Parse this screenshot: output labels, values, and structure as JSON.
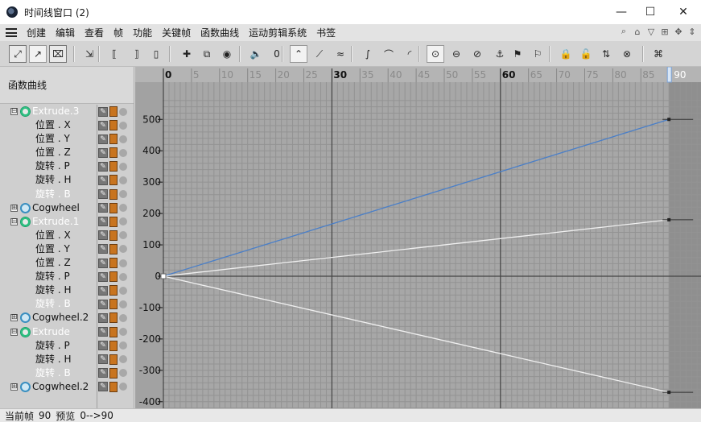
{
  "window": {
    "title": "时间线窗口 (2)",
    "controls": [
      "—",
      "☐",
      "✕"
    ]
  },
  "menu": {
    "items": [
      "创建",
      "编辑",
      "查看",
      "帧",
      "功能",
      "关键帧",
      "函数曲线",
      "运动剪辑系统",
      "书签"
    ],
    "right_icons": [
      "search-icon",
      "home-icon",
      "filter-icon",
      "add-panel-icon",
      "move-icon",
      "expand-icon"
    ]
  },
  "toolbar": {
    "icons": [
      "key-mode-icon",
      "fcurve-mode-icon",
      "motion-mode-icon",
      "snap-icon",
      "range-left-icon",
      "range-mid-icon",
      "range-right-icon",
      "add-key-icon",
      "add-keys-icon",
      "record-key-icon",
      "sound-icon",
      "zero-key-icon",
      "peak-icon",
      "linear-icon",
      "break-icon",
      "spline-icon",
      "ease-icon",
      "ease-out-icon",
      "clamp-icon",
      "zero-angle-icon",
      "zero-length-icon",
      "lock-tangent-icon",
      "lock-time-icon",
      "lock-value-icon",
      "key-lock-icon",
      "key-lock-time-icon",
      "key-lock-value-icon",
      "mute-icon",
      "motion-clip-icon"
    ]
  },
  "left_panel": {
    "header": "函数曲线",
    "rows": [
      {
        "kind": "obj",
        "label": "Extrude.3",
        "icon": "extrude",
        "expander": "⊟",
        "highlight": true
      },
      {
        "kind": "track",
        "label": "位置 . X",
        "highlight": false
      },
      {
        "kind": "track",
        "label": "位置 . Y",
        "highlight": false
      },
      {
        "kind": "track",
        "label": "位置 . Z",
        "highlight": false
      },
      {
        "kind": "track",
        "label": "旋转 . P",
        "highlight": false
      },
      {
        "kind": "track",
        "label": "旋转 . H",
        "highlight": false
      },
      {
        "kind": "track",
        "label": "旋转 . B",
        "highlight": true
      },
      {
        "kind": "obj",
        "label": "Cogwheel",
        "icon": "cog",
        "expander": "⊞",
        "highlight": false
      },
      {
        "kind": "obj",
        "label": "Extrude.1",
        "icon": "extrude",
        "expander": "⊟",
        "highlight": true
      },
      {
        "kind": "track",
        "label": "位置 . X",
        "highlight": false
      },
      {
        "kind": "track",
        "label": "位置 . Y",
        "highlight": false
      },
      {
        "kind": "track",
        "label": "位置 . Z",
        "highlight": false
      },
      {
        "kind": "track",
        "label": "旋转 . P",
        "highlight": false
      },
      {
        "kind": "track",
        "label": "旋转 . H",
        "highlight": false
      },
      {
        "kind": "track",
        "label": "旋转 . B",
        "highlight": true
      },
      {
        "kind": "obj",
        "label": "Cogwheel.2",
        "icon": "cog",
        "expander": "⊞",
        "highlight": false
      },
      {
        "kind": "obj",
        "label": "Extrude",
        "icon": "extrude",
        "expander": "⊟",
        "highlight": true
      },
      {
        "kind": "track",
        "label": "旋转 . P",
        "highlight": false
      },
      {
        "kind": "track",
        "label": "旋转 . H",
        "highlight": false
      },
      {
        "kind": "track",
        "label": "旋转 . B",
        "highlight": true
      },
      {
        "kind": "obj",
        "label": "Cogwheel.2",
        "icon": "cog",
        "expander": "⊞",
        "highlight": false
      }
    ]
  },
  "graph": {
    "frame_ticks": [
      0,
      5,
      10,
      15,
      20,
      25,
      30,
      35,
      40,
      45,
      50,
      55,
      60,
      65,
      70,
      75,
      80,
      85
    ],
    "major_frames": [
      0,
      30,
      60
    ],
    "current_frame": "90",
    "value_ticks": [
      500,
      400,
      300,
      200,
      100,
      0,
      -100,
      -200,
      -300,
      -400
    ],
    "curves": [
      {
        "color": "#4a7fc8",
        "from": [
          0,
          0
        ],
        "to": [
          90,
          500
        ]
      },
      {
        "color": "#f0f0f0",
        "from": [
          0,
          0
        ],
        "to": [
          90,
          180
        ]
      },
      {
        "color": "#f0f0f0",
        "from": [
          0,
          0
        ],
        "to": [
          90,
          -370
        ]
      }
    ]
  },
  "status": {
    "current_frame_label": "当前帧",
    "current_frame_value": "90",
    "preview_label": "预览",
    "preview_value": "0-->90"
  },
  "colors": {
    "graph_bg": "#a7a7a7",
    "grid_minor": "#939393",
    "grid_major": "#444444",
    "past_end_bg": "#8f8f8f",
    "accent_blue": "#4a7fc8",
    "highlight_text": "#ffffff"
  }
}
